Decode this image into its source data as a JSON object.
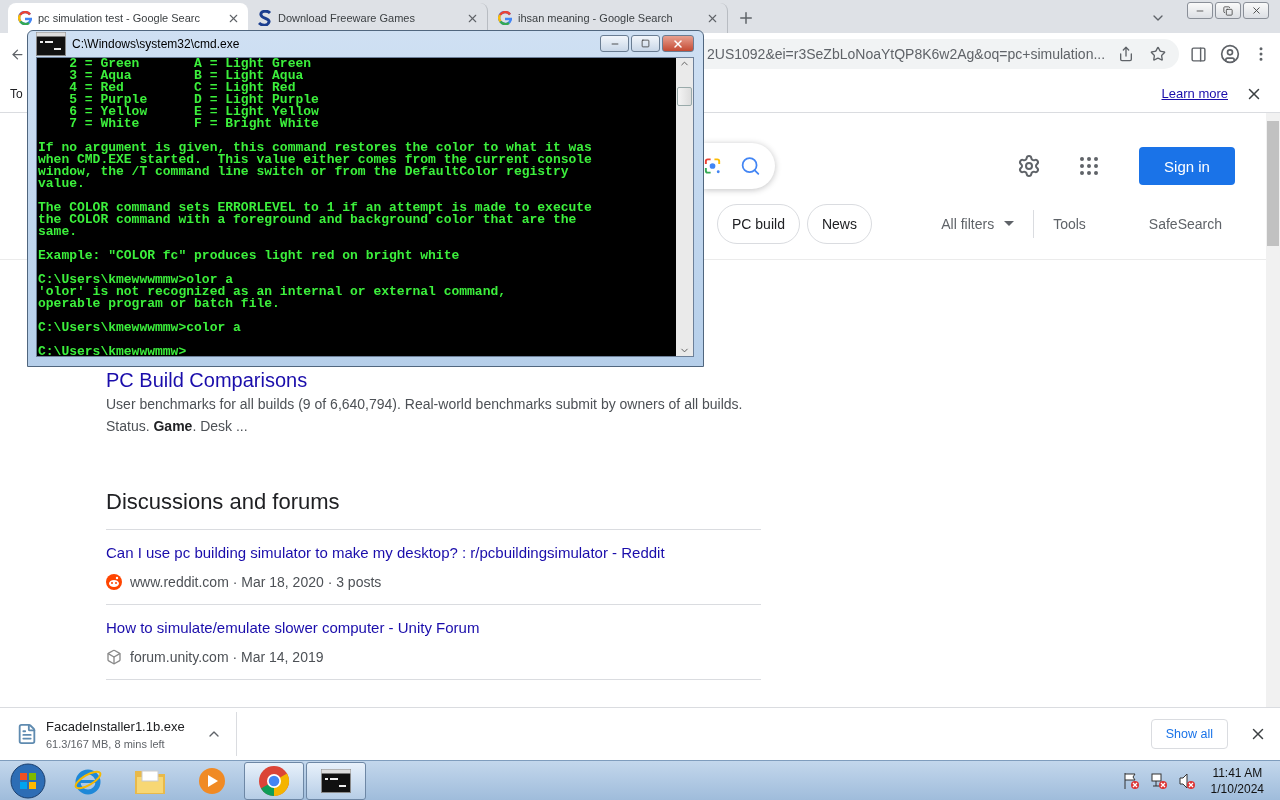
{
  "browser": {
    "tabs": [
      {
        "title": "pc simulation test - Google Searc",
        "kind": "google",
        "selected": true
      },
      {
        "title": "Download Freeware Games",
        "kind": "swoosh",
        "selected": false
      },
      {
        "title": "ihsan meaning - Google Search",
        "kind": "google",
        "selected": false
      }
    ],
    "address": "2US1092&ei=r3SeZbLoNoaYtQP8K6w2Ag&oq=pc+simulation...",
    "banner": {
      "text": "To",
      "link": "Learn more"
    }
  },
  "search_header": {
    "sign_in": "Sign in"
  },
  "chips": [
    {
      "label": "PC build"
    },
    {
      "label": "News"
    }
  ],
  "filters": {
    "all_filters": "All filters",
    "tools": "Tools",
    "safesearch": "SafeSearch"
  },
  "results": [
    {
      "title": "PC Build Comparisons",
      "snippet": "User benchmarks for all builds (9 of 6,640,794). Real-world benchmarks submit by owners of all builds. Status. **Game**. Desk ..."
    }
  ],
  "discussions": {
    "heading": "Discussions and forums",
    "items": [
      {
        "title": "Can I use pc building simulator to make my desktop? : r/pcbuildingsimulator - Reddit",
        "source": "www.reddit.com · Mar 18, 2020 · 3 posts",
        "kind": "reddit"
      },
      {
        "title": "How to simulate/emulate slower computer - Unity Forum",
        "source": "forum.unity.com · Mar 14, 2019",
        "kind": "unity"
      }
    ]
  },
  "download": {
    "file": "FacadeInstaller1.1b.exe",
    "status": "61.3/167 MB, 8 mins left",
    "show_all": "Show all"
  },
  "console": {
    "title": "C:\\Windows\\system32\\cmd.exe",
    "blocks": [
      [
        "    2 = Green       A = Light Green",
        "    3 = Aqua        B = Light Aqua",
        "    4 = Red         C = Light Red",
        "    5 = Purple      D = Light Purple",
        "    6 = Yellow      E = Light Yellow",
        "    7 = White       F = Bright White"
      ],
      [
        "If no argument is given, this command restores the color to what it was",
        "when CMD.EXE started.  This value either comes from the current console",
        "window, the /T command line switch or from the DefaultColor registry",
        "value."
      ],
      [
        "The COLOR command sets ERRORLEVEL to 1 if an attempt is made to execute",
        "the COLOR command with a foreground and background color that are the",
        "same."
      ],
      [
        "Example: \"COLOR fc\" produces light red on bright white"
      ],
      [
        "C:\\Users\\kmewwwmmw>olor a",
        "'olor' is not recognized as an internal or external command,",
        "operable program or batch file."
      ],
      [
        "C:\\Users\\kmewwwmmw>color a"
      ],
      [
        "C:\\Users\\kmewwwmmw>"
      ]
    ]
  },
  "taskbar": {
    "apps": [
      {
        "kind": "start",
        "selected": false
      },
      {
        "kind": "ie",
        "selected": false
      },
      {
        "kind": "explorer",
        "selected": false
      },
      {
        "kind": "media",
        "selected": false
      },
      {
        "kind": "chrome",
        "selected": true
      },
      {
        "kind": "cmd",
        "selected": true
      }
    ],
    "time": "11:41 AM",
    "date": "1/10/2024"
  }
}
